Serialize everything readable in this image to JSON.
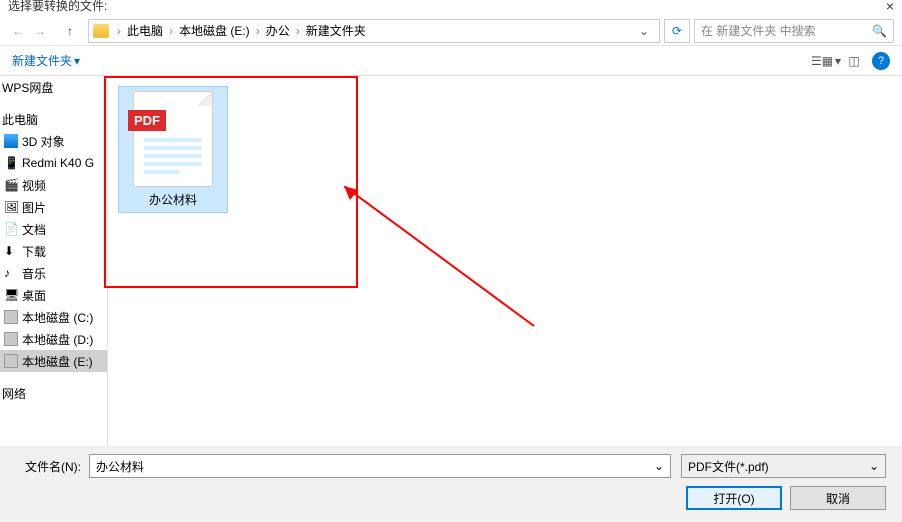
{
  "titlebar": {
    "title": "选择要转换的文件:"
  },
  "breadcrumb": {
    "items": [
      "此电脑",
      "本地磁盘 (E:)",
      "办公",
      "新建文件夹"
    ]
  },
  "search": {
    "placeholder": "在 新建文件夹 中搜索"
  },
  "toolbar": {
    "new_folder_label": "新建文件夹"
  },
  "sidebar": {
    "group1": {
      "header": "WPS网盘"
    },
    "group2": {
      "header": "此电脑",
      "items": [
        "3D 对象",
        "Redmi K40 G",
        "视频",
        "图片",
        "文档",
        "下载",
        "音乐",
        "桌面",
        "本地磁盘 (C:)",
        "本地磁盘 (D:)",
        "本地磁盘 (E:)"
      ]
    },
    "group3": {
      "header": "网络"
    }
  },
  "files": {
    "items": [
      {
        "name": "办公材料",
        "type": "pdf",
        "badge": "PDF",
        "selected": true
      }
    ]
  },
  "footer": {
    "filename_label": "文件名(N):",
    "filename_value": "办公材料",
    "filetype_value": "PDF文件(*.pdf)",
    "open_label": "打开(O)",
    "cancel_label": "取消"
  }
}
